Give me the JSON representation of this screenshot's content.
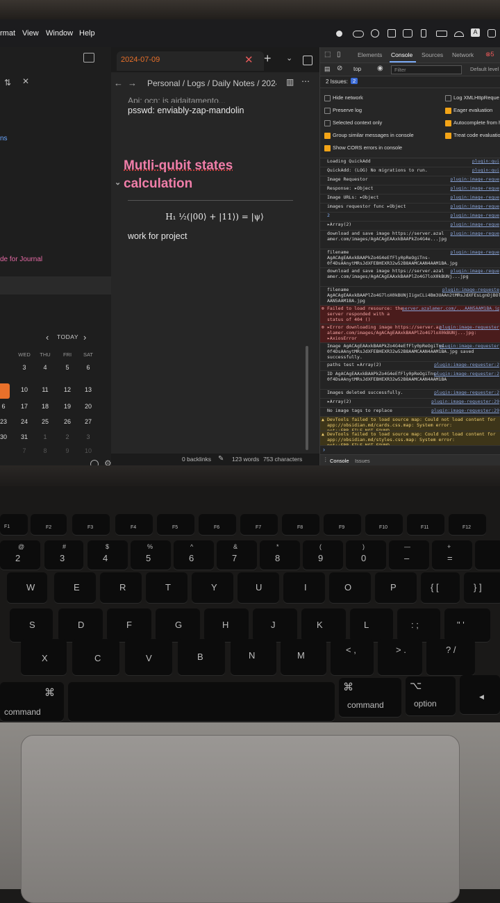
{
  "menubar": {
    "items": [
      "rmat",
      "View",
      "Window",
      "Help"
    ]
  },
  "left_pane": {
    "partial_link": "ns",
    "partial_item": "de for Journal"
  },
  "calendar": {
    "today_label": "TODAY",
    "weekdays": [
      "WED",
      "THU",
      "FRI",
      "SAT"
    ],
    "rows": [
      [
        "",
        "3",
        "4",
        "5",
        "6"
      ],
      [
        "",
        "10",
        "11",
        "12",
        "13"
      ],
      [
        "6",
        "17",
        "18",
        "19",
        "20"
      ],
      [
        "23",
        "24",
        "25",
        "26",
        "27"
      ],
      [
        "30",
        "31",
        "1",
        "2",
        "3"
      ],
      [
        "",
        "7",
        "8",
        "9",
        "10"
      ]
    ]
  },
  "tab": {
    "title": "2024-07-09"
  },
  "breadcrumb": {
    "text": "Personal / Logs / Daily Notes / 2024-("
  },
  "note": {
    "cut_line": "Api: ocn: is aidaitamento...",
    "password_line": "psswd: enviably-zap-mandolin",
    "heading_line1": "Mutli-qubit states",
    "heading_line2": "calculation",
    "equation": "H₁ ½(|00⟩ + |11⟩) = |ψ⟩",
    "body": "work for project"
  },
  "statusbar": {
    "backlinks": "0 backlinks",
    "words": "123 words",
    "characters": "753 characters"
  },
  "devtools": {
    "tabs": [
      "Elements",
      "Console",
      "Sources",
      "Network"
    ],
    "active_tab": "Console",
    "context": "top",
    "filter_placeholder": "Filter",
    "default_levels": "Default level",
    "issues": "2 Issues:",
    "issues_count": "2",
    "settings_left": [
      "Hide network",
      "Preserve log",
      "Selected context only",
      "Group similar messages in console",
      "Show CORS errors in console"
    ],
    "settings_right": [
      "Log XMLHttpReque",
      "Eager evaluation",
      "Autocomplete from hi",
      "Treat code evaluation"
    ],
    "logs": [
      {
        "text": "Loading QuickAdd",
        "src": "plugin:qui",
        "kind": "log"
      },
      {
        "text": "QuickAdd: (LOG) No migrations to run.",
        "src": "plugin:qui",
        "kind": "log"
      },
      {
        "text": "Image Requestor",
        "src": "plugin:image-reque",
        "kind": "log"
      },
      {
        "text": "Response: ▸Object",
        "src": "plugin:image-reque",
        "kind": "log"
      },
      {
        "text": "Image URLs: ▸Object",
        "src": "plugin:image-reque",
        "kind": "log"
      },
      {
        "text": "images requestor func ▸Object",
        "src": "plugin:image-reque",
        "kind": "log"
      },
      {
        "text": "2",
        "src": "plugin:image-reque",
        "kind": "log"
      },
      {
        "text": "▸Array(2)",
        "src": "plugin:image-reque",
        "kind": "log"
      },
      {
        "text": "download and save image https://server.azal amer.com/images/AgACAgEAAxkBAAPkZo4G4e...jpg",
        "src": "plugin:image-reque",
        "kind": "log"
      },
      {
        "text": "filename AgACAgEAAxkBAAPkZo4G4eEfFly0pReOgiTns-0f4DsAAnytMRsJdXFEBHEXR32w52B8AAMCAAN4AAM1BA.jpg",
        "src": "plugin:image-reque",
        "kind": "log"
      },
      {
        "text": "download and save image https://server.azal amer.com/images/AgACAgEAAxkBAAPlZo4G7loX0kBUNj...jpg",
        "src": "plugin:image-reque",
        "kind": "log"
      },
      {
        "text": "filename AgACAgEAAxkBAAPlZo4G7loX0kBUNjIigxCLi4Bm3UAAn2tMRsJdXFEsLgnDjBOl AAN5AAM1BA.jpg",
        "src": "plugin:image-requeste",
        "kind": "log"
      },
      {
        "text": "Failed to load resource: the server responded with a status of 404 ()",
        "src": "server.azalamer.com/...AAN5AAM1BA.jpg",
        "kind": "error"
      },
      {
        "text": "▸Error downloading image https://server.az alamer.com/images/AgACAgEAAxkBAAPlZo4G7loX0kBUNj...jpg: ▸AxiosError",
        "src": "plugin:image-requester",
        "kind": "error"
      },
      {
        "text": "Image AgACAgEAAxkBAAPkZo4G4eEfFly0pReOgiTns-0f4DsAAnytMRsJdXFEBHEXR32w52B8AAMCAAN4AAM1BA.jpg saved successfully.",
        "src": "plugin:image-requester",
        "kind": "log"
      },
      {
        "text": "paths test ▸Array(2)",
        "src": "plugin:image-requester:2",
        "kind": "log"
      },
      {
        "text": "ID AgACAgEAAxkBAAPkZo4G4eEfFly0pReOgiTns-0f4DsAAnytMRsJdXFEBHEXR32w52B8AAMCAAN4AAM1BA",
        "src": "plugin:image-requester:2",
        "kind": "log"
      },
      {
        "text": "Images deleted successfully.",
        "src": "plugin:image-requester:2",
        "kind": "log"
      },
      {
        "text": "▸Array(2)",
        "src": "plugin:image-requester:29",
        "kind": "log"
      },
      {
        "text": "No image tags to replace",
        "src": "plugin:image-requester:29",
        "kind": "log"
      },
      {
        "text": "DevTools failed to load source map: Could not load content for app://obsidian.md/cards.css.map: System error: net::ERR_FILE_NOT_FOUND",
        "src": "",
        "kind": "warning"
      },
      {
        "text": "DevTools failed to load source map: Could not load content for app://obsidian.md/styles.css.map: System error: net::ERR_FILE_NOT_FOUND",
        "src": "",
        "kind": "warning"
      }
    ],
    "drawer_tabs": [
      "Console",
      "Issues"
    ]
  },
  "keyboard": {
    "fn_row": [
      "F1",
      "F2",
      "F3",
      "F4",
      "F5",
      "F6",
      "F7",
      "F8",
      "F9",
      "F10",
      "F11",
      "F12"
    ],
    "num_row": [
      [
        "@",
        "2"
      ],
      [
        "#",
        "3"
      ],
      [
        "$",
        "4"
      ],
      [
        "%",
        "5"
      ],
      [
        "^",
        "6"
      ],
      [
        "&",
        "7"
      ],
      [
        "*",
        "8"
      ],
      [
        "(",
        "9"
      ],
      [
        ")",
        "0"
      ],
      [
        "—",
        "–"
      ],
      [
        "+",
        "="
      ]
    ],
    "top_row": [
      "W",
      "E",
      "R",
      "T",
      "Y",
      "U",
      "I",
      "O",
      "P",
      "{ [",
      "} ]"
    ],
    "home_row": [
      "S",
      "D",
      "F",
      "G",
      "H",
      "J",
      "K",
      "L",
      ": ;",
      "\" '"
    ],
    "bottom_row": [
      "X",
      "C",
      "V",
      "B",
      "N",
      "M",
      "< ,",
      "> .",
      "? /"
    ],
    "cmd_left_symbol": "⌘",
    "cmd_left_label": "command",
    "cmd_right_symbol": "⌘",
    "cmd_right_label": "command",
    "option_symbol": "⌥",
    "option_label": "option"
  }
}
